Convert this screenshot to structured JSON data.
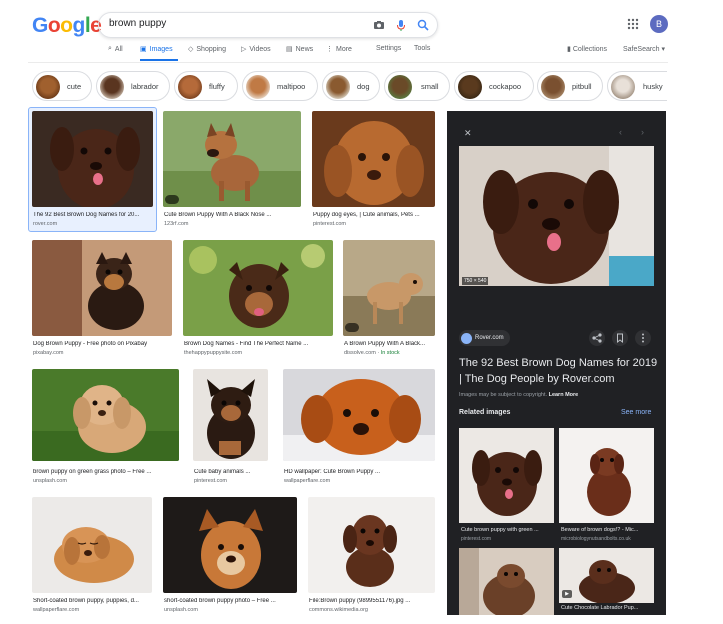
{
  "header": {
    "logo": "Google",
    "search_value": "brown puppy",
    "avatar_letter": "B"
  },
  "tabs": [
    {
      "label": "All"
    },
    {
      "label": "Images"
    },
    {
      "label": "Shopping"
    },
    {
      "label": "Videos"
    },
    {
      "label": "News"
    },
    {
      "label": "More"
    }
  ],
  "tools": {
    "settings": "Settings",
    "tools": "Tools",
    "collections": "Collections",
    "safesearch": "SafeSearch"
  },
  "chips": [
    "cute",
    "labrador",
    "fluffy",
    "maltipoo",
    "dog",
    "small",
    "cockapoo",
    "pitbull",
    "husky"
  ],
  "results": [
    {
      "caption": "The 92 Best Brown Dog Names for 20...",
      "source": "rover.com"
    },
    {
      "caption": "Cute Brown Puppy With A Black Nose ...",
      "source": "123rf.com"
    },
    {
      "caption": "Puppy dog eyes, | Cute animals, Pets ...",
      "source": "pinterest.com"
    },
    {
      "caption": "Dog Brown Puppy - Free photo on Pixabay",
      "source": "pixabay.com"
    },
    {
      "caption": "Brown Dog Names - Find The Perfect Name ...",
      "source": "thehappypuppysite.com"
    },
    {
      "caption": "A Brown Puppy With A Black...",
      "source": "dissolve.com",
      "stock": "In stock"
    },
    {
      "caption": "brown puppy on green grass photo – Free ...",
      "source": "unsplash.com"
    },
    {
      "caption": "Cute baby animals ...",
      "source": "pinterest.com"
    },
    {
      "caption": "HD wallpaper: Cute Brown Puppy ...",
      "source": "wallpaperflare.com"
    },
    {
      "caption": "Short-coated brown puppy, puppies, d...",
      "source": "wallpaperflare.com"
    },
    {
      "caption": "short-coated brown puppy photo – Free ...",
      "source": "unsplash.com"
    },
    {
      "caption": "File:Brown puppy (9899551176).jpg ...",
      "source": "commons.wikimedia.org"
    }
  ],
  "panel": {
    "close": "✕",
    "dimensions": "750 × 540",
    "site": "Rover.com",
    "title": "The 92 Best Brown Dog Names for 2019 | The Dog People by Rover.com",
    "copyright": "Images may be subject to copyright.",
    "learn_more": "Learn More",
    "related_heading": "Related images",
    "see_more": "See more",
    "related": [
      {
        "caption": "Cute brown puppy with green ...",
        "source": "pinterest.com"
      },
      {
        "caption": "Beware of brown dogs!? - Mic...",
        "source": "microbiologynutsandbolts.co.uk"
      },
      {
        "caption": "",
        "source": ""
      },
      {
        "caption": "Cute Chocolate Labrador Pup...",
        "source": ""
      }
    ]
  },
  "colors": {
    "accent": "#1a73e8",
    "panel_bg": "#202124",
    "link_dark": "#8ab4f8"
  }
}
